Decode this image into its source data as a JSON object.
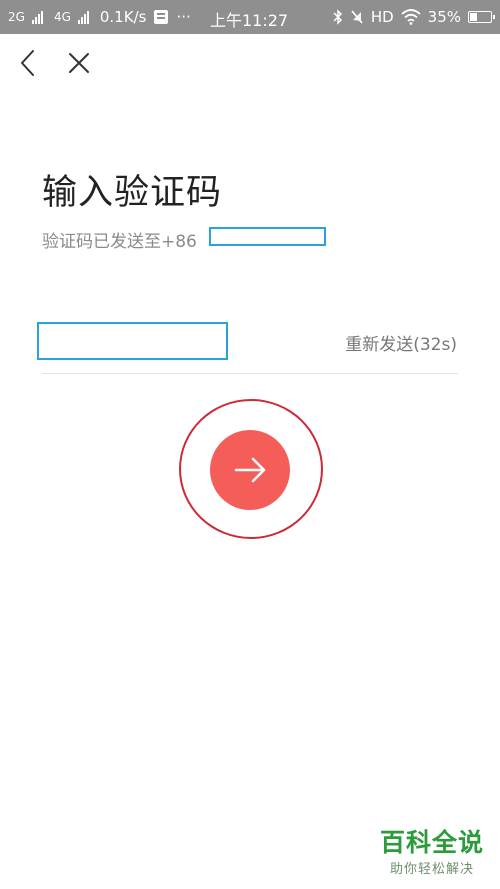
{
  "status_bar": {
    "net1": "2G",
    "net2": "4G",
    "speed": "0.1K/s",
    "more": "···",
    "time": "上午11:27",
    "hd": "HD",
    "battery_text": "35%",
    "battery_level": 0.35
  },
  "page": {
    "title": "输入验证码",
    "subtitle": "验证码已发送至+86",
    "code_value": "",
    "resend_label": "重新发送(32s)"
  },
  "watermark": {
    "title": "百科全说",
    "subtitle": "助你轻松解决"
  },
  "colors": {
    "status_bar": "#8f8f8f",
    "accent_button": "#f55d58",
    "redaction_box": "#29a3d8",
    "highlight_ring": "#cc2a36",
    "watermark": "#2c9b3a"
  }
}
